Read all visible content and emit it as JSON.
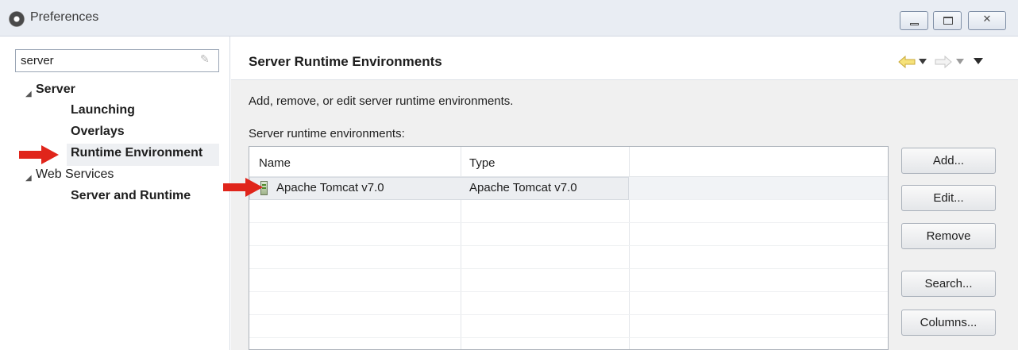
{
  "window": {
    "title": "Preferences",
    "buttons": {
      "minimize": "minimize",
      "maximize": "maximize",
      "close": "close"
    }
  },
  "left": {
    "filter_value": "server",
    "tree": [
      {
        "label": "Server",
        "expanded": true,
        "bold": true
      },
      {
        "label": "Launching",
        "bold": true
      },
      {
        "label": "Overlays",
        "bold": true
      },
      {
        "label": "Runtime Environment",
        "bold": true,
        "selected": true
      },
      {
        "label": "Web Services",
        "expanded": true,
        "bold": false
      },
      {
        "label": "Server and Runtime",
        "bold": true
      }
    ]
  },
  "right": {
    "title": "Server Runtime Environments",
    "description": "Add, remove, or edit server runtime environments.",
    "list_label": "Server runtime environments:",
    "table": {
      "columns": [
        "Name",
        "Type"
      ],
      "rows": [
        {
          "name": "Apache Tomcat v7.0",
          "type": "Apache Tomcat v7.0",
          "icon": "server-icon"
        }
      ]
    },
    "buttons": {
      "add": "Add...",
      "edit": "Edit...",
      "remove": "Remove",
      "search": "Search...",
      "columns": "Columns..."
    }
  },
  "colors": {
    "annotation_arrow": "#e0251b",
    "nav_arrow": "#e8d44d"
  }
}
